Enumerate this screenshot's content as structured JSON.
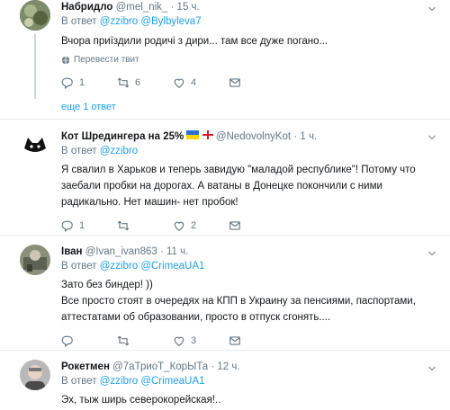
{
  "colors": {
    "link": "#1da1f2",
    "muted": "#657786",
    "text": "#14171a",
    "border": "#e6ecf0"
  },
  "icons": {
    "reply": "reply-icon",
    "retweet": "retweet-icon",
    "like": "heart-icon",
    "dm": "envelope-icon",
    "menu": "chevron-down-icon",
    "globe": "globe-icon"
  },
  "tweets": [
    {
      "name": "Набридло",
      "handle": "@mel_nik_",
      "dot": "·",
      "time": "15 ч.",
      "reply_prefix": "В ответ",
      "reply_to": [
        "@zzibro",
        "@Bylbyleva7"
      ],
      "text": "Вчора приїздили родичі з дири... там все дуже погано...",
      "translate": "Перевести твит",
      "replies": "1",
      "retweets": "6",
      "likes": "4",
      "more_replies": "еще 1 ответ"
    },
    {
      "name": "Кот Шредингера на 25%",
      "handle": "@NedovolnyKot",
      "dot": "·",
      "time": "1 ч.",
      "reply_prefix": "В ответ",
      "reply_to": [
        "@zzibro"
      ],
      "text": "Я свалил в Харьков и теперь завидую \"маладой республике\"! Потому что заебали пробки на дорогах. А ватаны в Донецке покончили с ними радикально. Нет машин- нет пробок!",
      "replies": "1",
      "retweets": "",
      "likes": "2"
    },
    {
      "name": "Іван",
      "handle": "@Ivan_ivan863",
      "dot": "·",
      "time": "11 ч.",
      "reply_prefix": "В ответ",
      "reply_to": [
        "@zzibro",
        "@CrimeaUA1"
      ],
      "text_line1": "Зато без биндер! ))",
      "text": "Все просто стоят в очередях на КПП в Украину за пенсиями, паспортами, аттестатами об образовании, просто в отпуск сгонять....",
      "replies": "",
      "retweets": "",
      "likes": "3"
    },
    {
      "name": "Рокетмен",
      "handle": "@7аТриоТ_КорЫТа",
      "dot": "·",
      "time": "12 ч.",
      "reply_prefix": "В ответ",
      "reply_to": [
        "@zzibro",
        "@CrimeaUA1"
      ],
      "text": "Эх, тыж ширь северокорейская!.."
    }
  ]
}
